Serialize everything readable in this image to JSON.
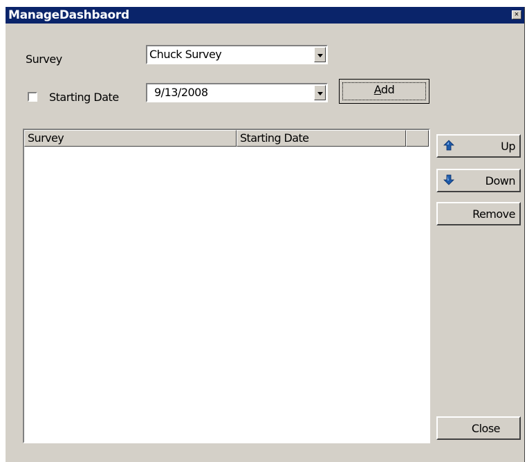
{
  "window": {
    "title": "ManageDashbaord",
    "close_glyph": "×"
  },
  "form": {
    "survey_label": "Survey",
    "survey_value": "Chuck Survey",
    "starting_date_label": "Starting Date",
    "starting_date_checked": false,
    "starting_date_value": "9/13/2008",
    "add_label_prefix": "",
    "add_label_underlined": "A",
    "add_label_rest": "dd"
  },
  "list": {
    "columns": [
      "Survey",
      "Starting Date",
      ""
    ],
    "rows": []
  },
  "side_buttons": {
    "up_label": "Up",
    "up_icon": "arrow-up-icon",
    "down_label": "Down",
    "down_icon": "arrow-down-icon",
    "remove_label": "Remove",
    "close_label": "Close"
  },
  "colors": {
    "titlebar": "#0a246a",
    "face": "#d4d0c8",
    "arrow_blue": "#1e5aa8"
  }
}
